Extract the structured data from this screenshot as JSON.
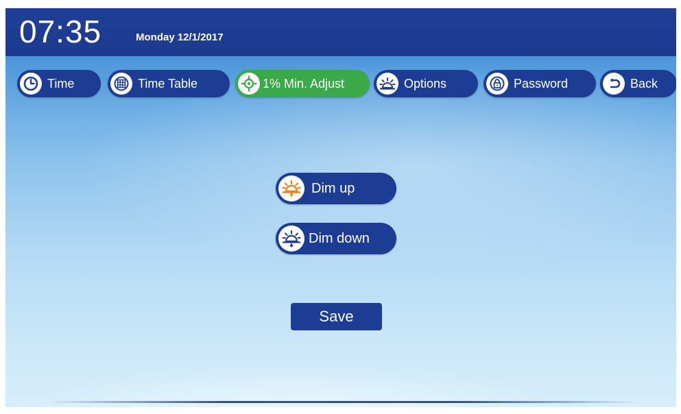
{
  "header": {
    "clock": "07:35",
    "date": "Monday 12/1/2017"
  },
  "tabs": [
    {
      "label": "Time",
      "icon": "clock-icon"
    },
    {
      "label": "Time Table",
      "icon": "grid-icon"
    },
    {
      "label": "1% Min. Adjust",
      "icon": "target-icon",
      "active": true
    },
    {
      "label": "Options",
      "icon": "alarm-icon"
    },
    {
      "label": "Password",
      "icon": "lock-icon"
    },
    {
      "label": "Back",
      "icon": "back-arrow-icon"
    }
  ],
  "controls": {
    "dim_up": "Dim up",
    "dim_down": "Dim down",
    "save": "Save"
  },
  "colors": {
    "navy": "#1d3c93",
    "active_green": "#3aa949",
    "dim_up_icon": "#f0821e"
  }
}
